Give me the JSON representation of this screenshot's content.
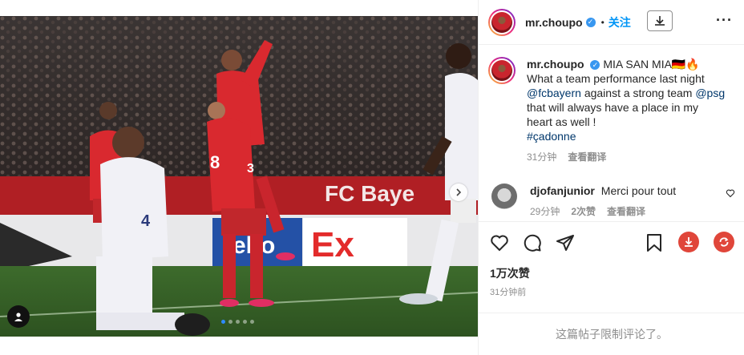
{
  "post": {
    "author": "mr.choupo",
    "verified_mark": "✓",
    "dot": "•",
    "follow_label": "关注",
    "more_label": "···"
  },
  "caption": {
    "user": "mr.choupo",
    "text_1": "MIA SAN MIA",
    "emoji": "🇩🇪🔥",
    "text_2": "What a team performance last night",
    "mention_1": "@fcbayern",
    "text_3": "against a strong team",
    "mention_2": "@psg",
    "text_4": "that will always have a place in my heart as well !",
    "hashtag": "#çadonne",
    "time": "31分钟",
    "translate": "查看翻译"
  },
  "comment": {
    "user": "djofanjunior",
    "text": "Merci pour tout",
    "time": "29分钟",
    "replies": "2次赞",
    "translate": "查看翻译"
  },
  "stats": {
    "likes": "1万次赞",
    "posted": "31分钟前"
  },
  "footer": {
    "restricted": "这篇帖子限制评论了。"
  },
  "photo": {
    "banner_text": "FC Baye",
    "ad_text": "Ex",
    "ad_text_2": "ebo",
    "jersey_number": "8",
    "jersey_number_2": "3",
    "jersey_number_3": "4"
  },
  "carousel": {
    "slides": 5,
    "active": 1
  },
  "colors": {
    "accent": "#0095f6",
    "link": "#00376b",
    "muted": "#8e8e8e",
    "download_red": "#e0463a"
  },
  "icons": [
    "verified-icon",
    "download-icon",
    "more-icon",
    "heart-icon",
    "comment-icon",
    "share-icon",
    "bookmark-icon",
    "save-media-icon",
    "repost-icon",
    "tag-user-icon",
    "chevron-right-icon"
  ]
}
